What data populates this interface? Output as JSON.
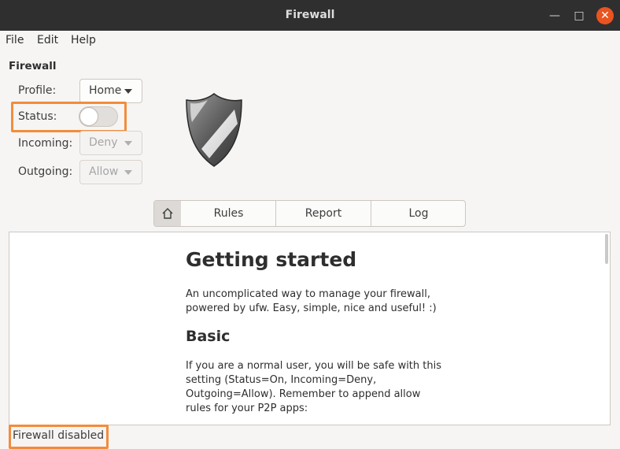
{
  "window": {
    "title": "Firewall"
  },
  "menu": [
    "File",
    "Edit",
    "Help"
  ],
  "panel": {
    "title": "Firewall",
    "profile_label": "Profile:",
    "profile_value": "Home",
    "status_label": "Status:",
    "status_on": false,
    "incoming_label": "Incoming:",
    "incoming_value": "Deny",
    "outgoing_label": "Outgoing:",
    "outgoing_value": "Allow"
  },
  "tabs": {
    "home_icon": "home-icon",
    "rules": "Rules",
    "report": "Report",
    "log": "Log"
  },
  "doc": {
    "heading": "Getting started",
    "intro": "An uncomplicated way to manage your firewall, powered by ufw. Easy, simple, nice and useful! :)",
    "subheading": "Basic",
    "basic_text": "If you are a normal user, you will be safe with this setting (Status=On, Incoming=Deny, Outgoing=Allow). Remember to append allow rules for your P2P apps:"
  },
  "statusbar": {
    "text": "Firewall disabled"
  },
  "colors": {
    "highlight": "#f28c3c",
    "close_button": "#e95420",
    "titlebar": "#2f2f2f"
  }
}
